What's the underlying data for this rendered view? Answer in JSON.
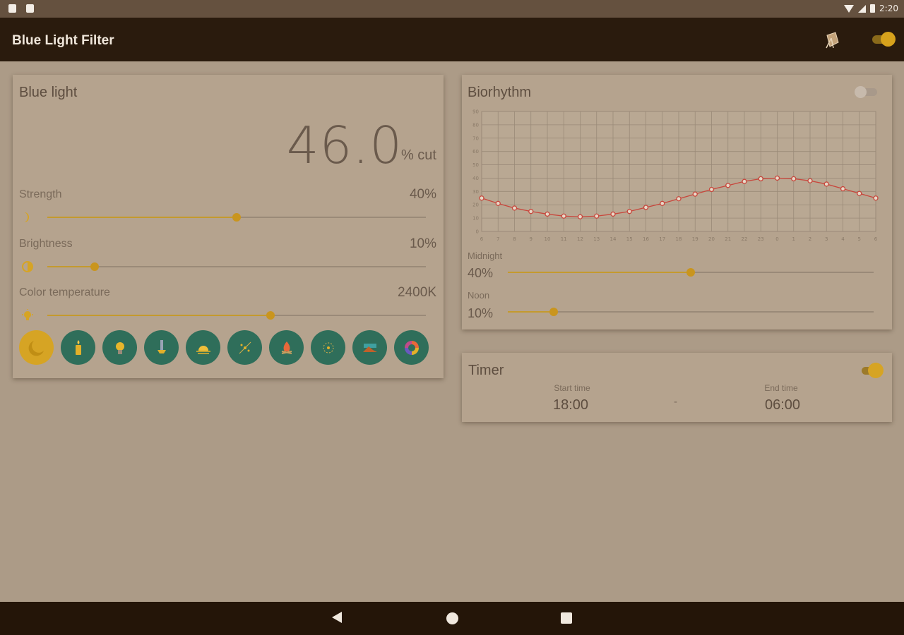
{
  "status_bar": {
    "time": "2:20"
  },
  "app": {
    "title": "Blue Light Filter"
  },
  "blue_light": {
    "title": "Blue light",
    "cut_value": "46.0",
    "cut_unit": "% cut",
    "strength": {
      "label": "Strength",
      "value_text": "40%",
      "fraction": 0.5
    },
    "brightness": {
      "label": "Brightness",
      "value_text": "10%",
      "fraction": 0.125
    },
    "color_temperature": {
      "label": "Color temperature",
      "value_text": "2400K",
      "fraction": 0.59
    },
    "presets": [
      {
        "icon": "moon-icon",
        "active": true
      },
      {
        "icon": "candle-icon",
        "active": false
      },
      {
        "icon": "bulb-icon",
        "active": false
      },
      {
        "icon": "lamp-icon",
        "active": false
      },
      {
        "icon": "sunrise-icon",
        "active": false
      },
      {
        "icon": "stars-icon",
        "active": false
      },
      {
        "icon": "campfire-icon",
        "active": false
      },
      {
        "icon": "sparkle-icon",
        "active": false
      },
      {
        "icon": "landscape-icon",
        "active": false
      },
      {
        "icon": "color-wheel-icon",
        "active": false
      }
    ]
  },
  "biorhythm": {
    "title": "Biorhythm",
    "enabled": false,
    "midnight": {
      "label": "Midnight",
      "value_text": "40%",
      "fraction": 0.5
    },
    "noon": {
      "label": "Noon",
      "value_text": "10%",
      "fraction": 0.125
    }
  },
  "chart_data": {
    "type": "line",
    "x": [
      "6",
      "7",
      "8",
      "9",
      "10",
      "11",
      "12",
      "13",
      "14",
      "15",
      "16",
      "17",
      "18",
      "19",
      "20",
      "21",
      "22",
      "23",
      "0",
      "1",
      "2",
      "3",
      "4",
      "5",
      "6"
    ],
    "y_ticks": [
      "0",
      "10",
      "20",
      "30",
      "40",
      "50",
      "60",
      "70",
      "80",
      "90"
    ],
    "ylim": [
      0,
      90
    ],
    "grid": true,
    "series": [
      {
        "values": [
          25,
          21,
          17.5,
          15,
          13,
          11.5,
          11,
          11.5,
          13,
          15,
          18,
          21,
          24.5,
          28,
          31.5,
          34.5,
          37.5,
          39.5,
          40,
          39.5,
          38,
          35.5,
          32,
          28.5,
          25
        ]
      }
    ],
    "colors": {
      "line": "#c8463c",
      "marker": "#c8463c"
    }
  },
  "timer": {
    "title": "Timer",
    "enabled": true,
    "start_label": "Start time",
    "start_value": "18:00",
    "separator": "-",
    "end_label": "End time",
    "end_value": "06:00"
  },
  "colors": {
    "accent": "#d6a424",
    "preset_bg": "#2f6e5a",
    "app_bar": "#2a1b0d",
    "background": "#ac9b87",
    "card": "#b5a38e"
  }
}
